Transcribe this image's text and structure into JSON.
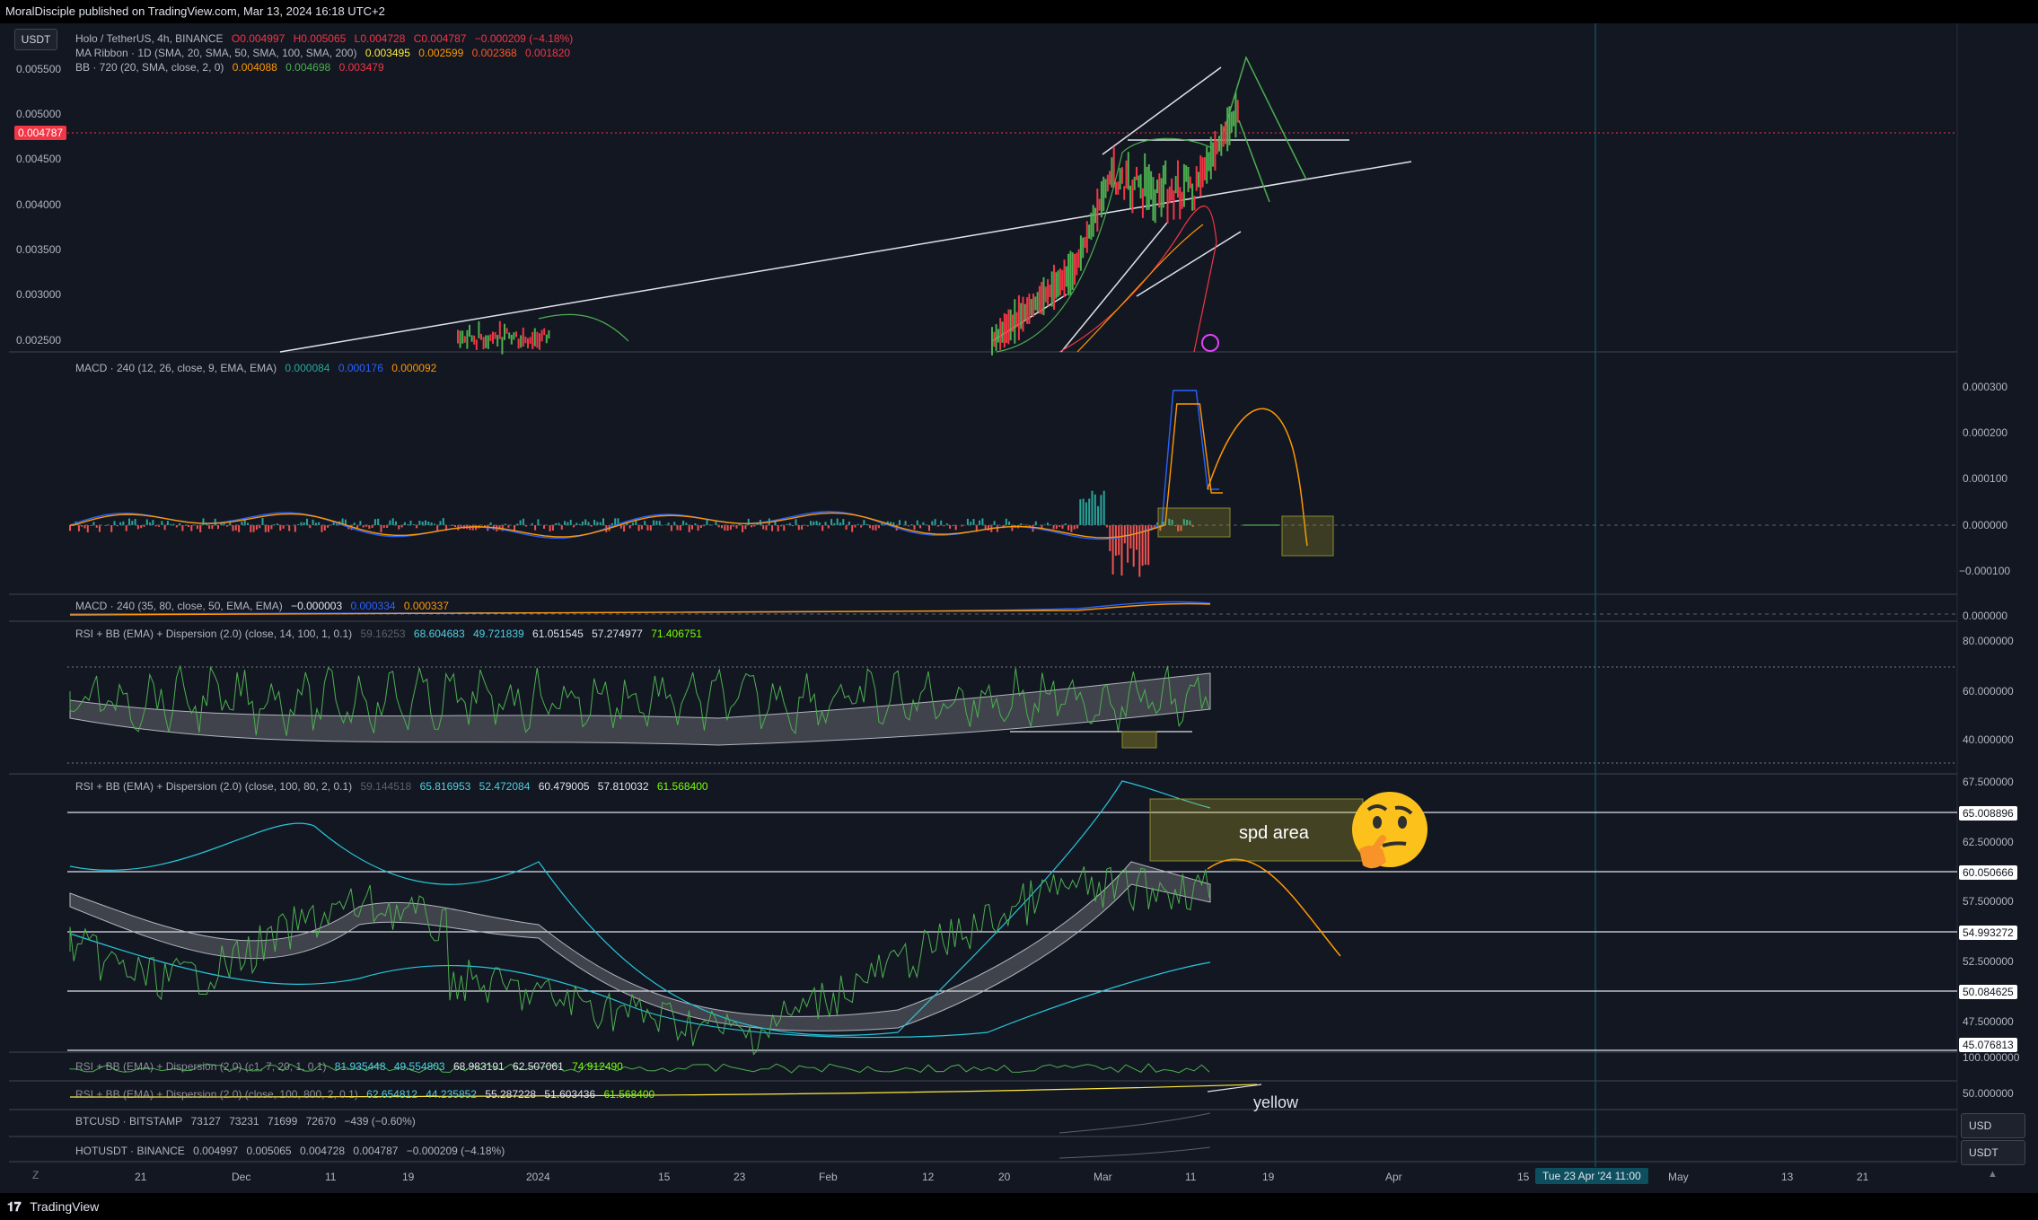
{
  "header": {
    "publisher": "MoralDisciple published on TradingView.com, Mar 13, 2024 16:18 UTC+2"
  },
  "footer": {
    "brand": "TradingView",
    "brand_icon": "tradingview-logo-icon"
  },
  "toolbar": {
    "currency_button": "USDT",
    "currency_options": [
      "USD",
      "USDT"
    ]
  },
  "main_pane": {
    "symbol": "Holo / TetherUS, 4h, BINANCE",
    "ohlc": {
      "o": "O0.004997",
      "h": "H0.005065",
      "l": "L0.004728",
      "c": "C0.004787",
      "chg": "−0.000209 (−4.18%)"
    },
    "ma_ribbon": {
      "label": "MA Ribbon · 1D (SMA, 20, SMA, 50, SMA, 100, SMA, 200)",
      "values": [
        "0.003495",
        "0.002599",
        "0.002368",
        "0.001820"
      ]
    },
    "bb": {
      "label": "BB · 720 (20, SMA, close, 2, 0)",
      "values": [
        "0.004088",
        "0.004698",
        "0.003479"
      ]
    },
    "price_axis": [
      "0.005500",
      "0.005000",
      "0.004500",
      "0.004000",
      "0.003500",
      "0.003000",
      "0.002500"
    ],
    "last_price": "0.004787"
  },
  "macd1": {
    "label": "MACD · 240 (12, 26, close, 9, EMA, EMA)",
    "values": [
      "0.000084",
      "0.000176",
      "0.000092"
    ],
    "axis": [
      "0.000300",
      "0.000200",
      "0.000100",
      "0.000000",
      "−0.000100"
    ]
  },
  "macd2": {
    "label": "MACD · 240 (35, 80, close, 50, EMA, EMA)",
    "values": [
      "−0.000003",
      "0.000334",
      "0.000337"
    ],
    "axis": [
      "0.000000"
    ]
  },
  "rsi1": {
    "label": "RSI + BB (EMA) + Dispersion (2.0) (close, 14, 100, 1, 0.1)",
    "values": [
      "59.16253",
      "68.604683",
      "49.721839",
      "61.051545",
      "57.274977",
      "71.406751"
    ],
    "axis": [
      "80.000000",
      "60.000000",
      "40.000000"
    ]
  },
  "rsi2": {
    "label": "RSI + BB (EMA) + Dispersion (2.0) (close, 100, 80, 2, 0.1)",
    "values": [
      "59.144518",
      "65.816953",
      "52.472084",
      "60.479005",
      "57.810032",
      "61.568400"
    ],
    "axis": [
      "67.500000",
      "62.500000",
      "57.500000",
      "52.500000",
      "47.500000"
    ],
    "levels": [
      "65.008896",
      "60.050666",
      "54.993272",
      "50.084625",
      "45.076813"
    ],
    "annotation": "spd area"
  },
  "rsi3": {
    "label": "RSI + BB (EMA) + Dispersion (2.0) (c1, 7, 20, 1, 0.1)",
    "values": [
      "81.935448",
      "49.554803",
      "68.983191",
      "62.507061",
      "74.912490"
    ],
    "axis": [
      "100.000000"
    ]
  },
  "rsi4": {
    "label": "RSI + BB (EMA) + Dispersion (2.0) (close, 100, 800, 2, 0.1)",
    "values": [
      "62.654812",
      "44.235852",
      "55.287228",
      "51.603436",
      "61.568400"
    ],
    "axis": [
      "50.000000"
    ],
    "annotation": "yellow"
  },
  "btc": {
    "label": "BTCUSD · BITSTAMP",
    "values": [
      "73127",
      "73231",
      "71699",
      "72670",
      "−439 (−0.60%)"
    ]
  },
  "hot": {
    "label": "HOTUSDT · BINANCE",
    "values": [
      "0.004997",
      "0.005065",
      "0.004728",
      "0.004787",
      "−0.000209 (−4.18%)"
    ]
  },
  "time_axis": [
    "21",
    "Dec",
    "11",
    "19",
    "2024",
    "15",
    "23",
    "Feb",
    "12",
    "20",
    "Mar",
    "11",
    "19",
    "Apr",
    "15",
    "May",
    "13",
    "21"
  ],
  "crosshair_time": "Tue 23 Apr '24   11:00",
  "icons": [
    "zoom-icon",
    "scroll-up-icon",
    "lightning-icon",
    "thinking-face-emoji"
  ],
  "colors": {
    "bg": "#131722",
    "up": "#4caf50",
    "down": "#f23645",
    "macd": "#2962ff",
    "signal": "#ff9800",
    "last": "#f23645",
    "cross": "#0d4f5e"
  }
}
